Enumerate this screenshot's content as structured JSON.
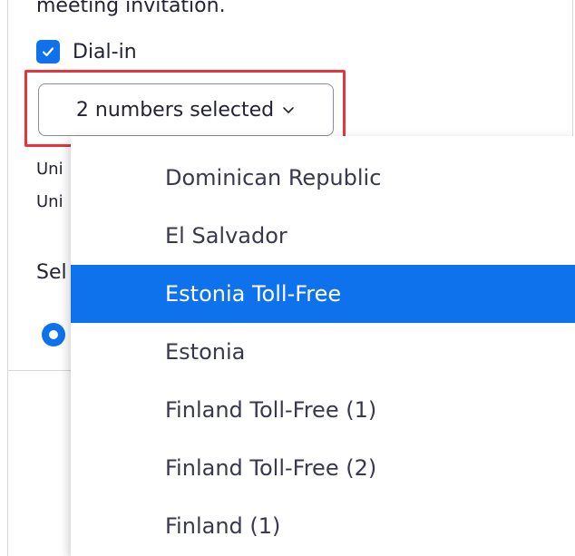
{
  "invitation": {
    "text": "meeting invitation."
  },
  "dialin": {
    "label": "Dial-in",
    "checked": true
  },
  "number_select": {
    "label": "2 numbers selected"
  },
  "background_lines": [
    {
      "text": "Uni"
    },
    {
      "text": "Uni"
    },
    {
      "text": "Sel"
    }
  ],
  "dropdown": {
    "options": [
      {
        "label": "Dominican Republic",
        "selected": false
      },
      {
        "label": "El Salvador",
        "selected": false
      },
      {
        "label": "Estonia Toll-Free",
        "selected": true
      },
      {
        "label": "Estonia",
        "selected": false
      },
      {
        "label": "Finland Toll-Free (1)",
        "selected": false
      },
      {
        "label": "Finland Toll-Free (2)",
        "selected": false
      },
      {
        "label": "Finland (1)",
        "selected": false
      }
    ]
  },
  "colors": {
    "accent": "#0e72ed",
    "highlight_border": "#e8343d"
  }
}
